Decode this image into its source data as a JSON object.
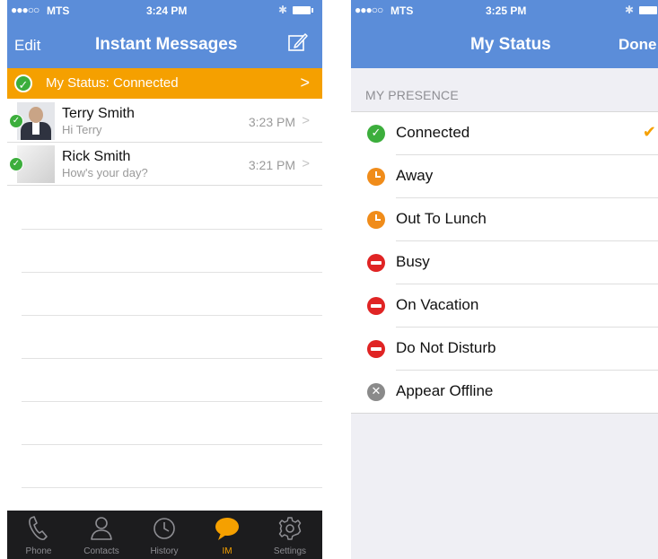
{
  "left_screen": {
    "status_bar": {
      "signal": "●●●○○",
      "carrier": "MTS",
      "time": "3:24 PM"
    },
    "nav": {
      "edit_label": "Edit",
      "title": "Instant Messages",
      "compose_icon": "compose-icon"
    },
    "status_banner": {
      "text": "My Status: Connected",
      "chevron": ">"
    },
    "conversations": [
      {
        "name": "Terry Smith",
        "preview": "Hi Terry",
        "time": "3:23 PM",
        "chevron": ">"
      },
      {
        "name": "Rick Smith",
        "preview": "How's your day?",
        "time": "3:21 PM",
        "chevron": ">"
      }
    ],
    "tabs": [
      {
        "label": "Phone",
        "icon": "phone-icon"
      },
      {
        "label": "Contacts",
        "icon": "contacts-icon"
      },
      {
        "label": "History",
        "icon": "clock-icon"
      },
      {
        "label": "IM",
        "icon": "chat-bubble-icon",
        "active": true
      },
      {
        "label": "Settings",
        "icon": "gear-icon"
      }
    ]
  },
  "right_screen": {
    "status_bar": {
      "signal": "●●●○○",
      "carrier": "MTS",
      "time": "3:25 PM"
    },
    "nav": {
      "title": "My Status",
      "done_label": "Done"
    },
    "section_header": "MY PRESENCE",
    "presence_options": [
      {
        "label": "Connected",
        "icon": "connected-icon",
        "selected": true
      },
      {
        "label": "Away",
        "icon": "away-clock-icon"
      },
      {
        "label": "Out To Lunch",
        "icon": "lunch-clock-icon"
      },
      {
        "label": "Busy",
        "icon": "busy-icon"
      },
      {
        "label": "On Vacation",
        "icon": "vacation-icon"
      },
      {
        "label": "Do Not Disturb",
        "icon": "dnd-icon"
      },
      {
        "label": "Appear Offline",
        "icon": "offline-icon"
      }
    ]
  },
  "colors": {
    "nav_blue": "#5b8dd9",
    "accent_orange": "#f5a000",
    "status_green": "#3cae3c",
    "status_red": "#e02424",
    "tab_bar": "#1c1c1e"
  }
}
